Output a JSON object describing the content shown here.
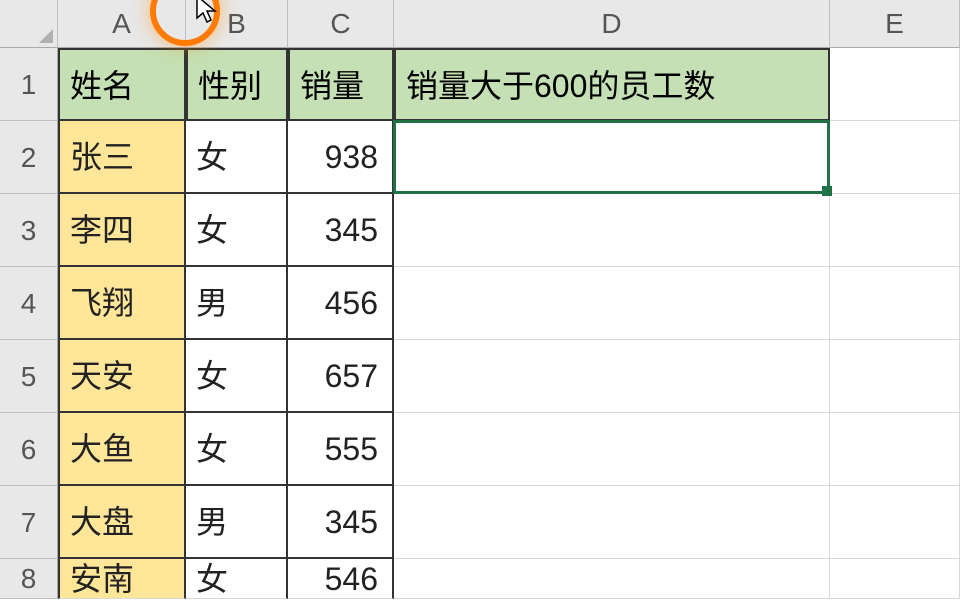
{
  "columns": {
    "A": "A",
    "B": "B",
    "C": "C",
    "D": "D",
    "E": "E"
  },
  "row_labels": [
    "1",
    "2",
    "3",
    "4",
    "5",
    "6",
    "7",
    "8"
  ],
  "header": {
    "name": "姓名",
    "gender": "性别",
    "sales": "销量",
    "criteria": "销量大于600的员工数"
  },
  "rows": [
    {
      "name": "张三",
      "gender": "女",
      "sales": "938"
    },
    {
      "name": "李四",
      "gender": "女",
      "sales": "345"
    },
    {
      "name": "飞翔",
      "gender": "男",
      "sales": "456"
    },
    {
      "name": "天安",
      "gender": "女",
      "sales": "657"
    },
    {
      "name": "大鱼",
      "gender": "女",
      "sales": "555"
    },
    {
      "name": "大盘",
      "gender": "男",
      "sales": "345"
    },
    {
      "name": "安南",
      "gender": "女",
      "sales": "546"
    }
  ],
  "selected_cell": "D2",
  "cursor_position": {
    "col_boundary": "A|B"
  },
  "colors": {
    "header_fill": "#c5e0b4",
    "name_fill": "#ffe699",
    "selection": "#1f7246",
    "highlight_ring": "#ff7a00"
  }
}
